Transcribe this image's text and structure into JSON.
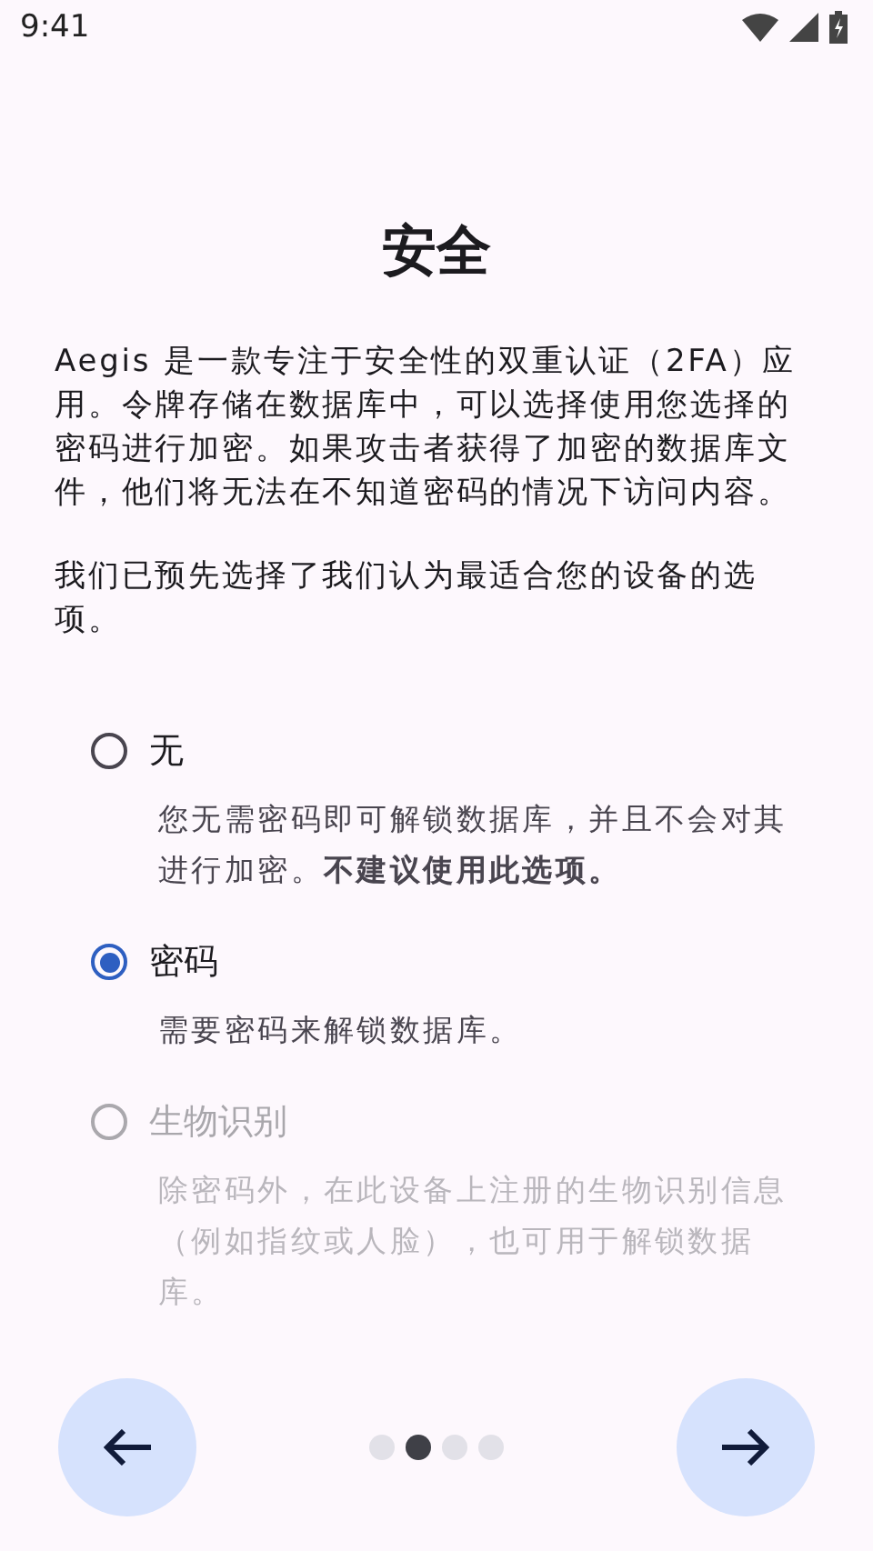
{
  "status_bar": {
    "time": "9:41"
  },
  "title": "安全",
  "intro": [
    "Aegis 是一款专注于安全性的双重认证（2FA）应用。令牌存储在数据库中，可以选择使用您选择的密码进行加密。如果攻击者获得了加密的数据库文件，他们将无法在不知道密码的情况下访问内容。",
    "我们已预先选择了我们认为最适合您的设备的选项。"
  ],
  "options": [
    {
      "label": "无",
      "description": "您无需密码即可解锁数据库，并且不会对其进行加密。**不建议使用此选项。**",
      "selected": false,
      "disabled": false
    },
    {
      "label": "密码",
      "description": "需要密码来解锁数据库。",
      "selected": true,
      "disabled": false
    },
    {
      "label": "生物识别",
      "description": "除密码外，在此设备上注册的生物识别信息（例如指纹或人脸），也可用于解锁数据库。",
      "selected": false,
      "disabled": true
    }
  ],
  "pager": [
    {
      "selected": false
    },
    {
      "selected": true
    },
    {
      "selected": false
    },
    {
      "selected": false
    }
  ]
}
